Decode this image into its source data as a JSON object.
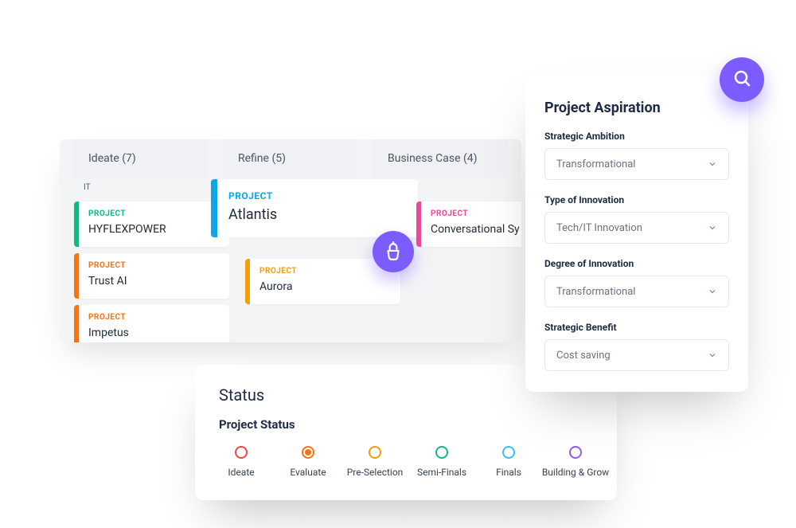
{
  "board": {
    "truncated_top": "IT",
    "columns": [
      {
        "header": "Ideate (7)"
      },
      {
        "header": "Refine (5)"
      },
      {
        "header": "Business Case (4)"
      }
    ],
    "tag": "PROJECT",
    "cards": {
      "hyflex": "HYFLEXPOWER",
      "trust": "Trust AI",
      "impetus": "Impetus",
      "atlantis": "Atlantis",
      "aurora": "Aurora",
      "convai": "Conversational Sy"
    }
  },
  "aspiration": {
    "title": "Project Aspiration",
    "fields": [
      {
        "label": "Strategic Ambition",
        "value": "Transformational"
      },
      {
        "label": "Type of Innovation",
        "value": "Tech/IT Innovation"
      },
      {
        "label": "Degree of Innovation",
        "value": "Transformational"
      },
      {
        "label": "Strategic Benefit",
        "value": "Cost saving"
      }
    ]
  },
  "status": {
    "title": "Status",
    "subtitle": "Project Status",
    "items": [
      {
        "label": "Ideate",
        "color": "#ef4444",
        "filled": false
      },
      {
        "label": "Evaluate",
        "color": "#f97316",
        "filled": true
      },
      {
        "label": "Pre-Selection",
        "color": "#f59e0b",
        "filled": false
      },
      {
        "label": "Semi-Finals",
        "color": "#10b981",
        "filled": false
      },
      {
        "label": "Finals",
        "color": "#38bdf8",
        "filled": false
      },
      {
        "label": "Building & Grow",
        "color": "#8b5cf6",
        "filled": false
      }
    ]
  }
}
